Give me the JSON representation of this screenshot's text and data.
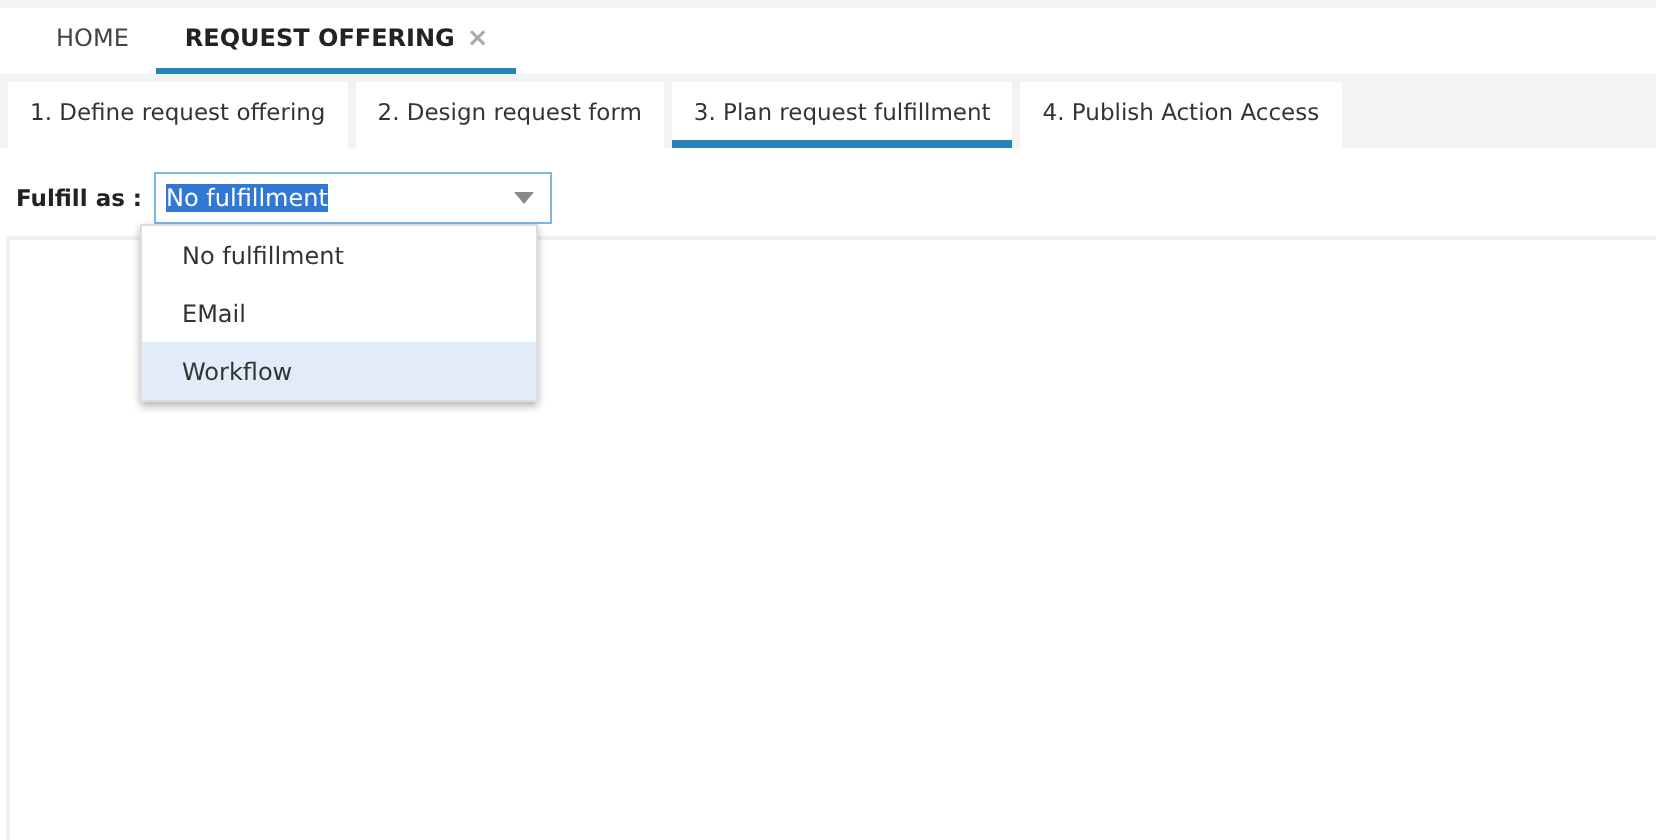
{
  "tabs": [
    {
      "label": "HOME",
      "selected": false
    },
    {
      "label": "REQUEST OFFERING",
      "selected": true,
      "close": "×"
    }
  ],
  "steps": [
    {
      "label": "1. Define request offering",
      "selected": false
    },
    {
      "label": "2. Design request form",
      "selected": false
    },
    {
      "label": "3. Plan request fulfillment",
      "selected": true
    },
    {
      "label": "4. Publish Action Access",
      "selected": false
    }
  ],
  "fulfill": {
    "label": "Fulfill as :",
    "value": "No fulfillment",
    "expanded": true,
    "options": [
      {
        "label": "No fulfillment",
        "highlighted": false
      },
      {
        "label": "EMail",
        "highlighted": false
      },
      {
        "label": "Workflow",
        "highlighted": true
      }
    ]
  }
}
